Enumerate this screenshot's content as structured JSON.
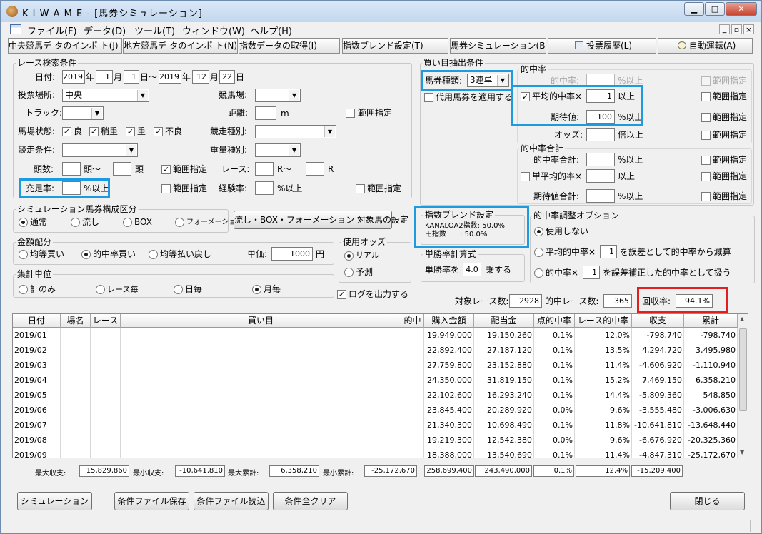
{
  "window": {
    "title": "K I W A M E - [馬券シミュレーション]",
    "min": "▁",
    "max": "□",
    "close": "✕"
  },
  "mdi": {
    "min": "‗",
    "restore": "▫",
    "close": "×"
  },
  "menu": [
    "ファイル(F)",
    "データ(D)",
    "ツール(T)",
    "ウィンドウ(W)",
    "ヘルプ(H)"
  ],
  "toolbar": [
    "中央競馬デ-タのインポ-ト(J)",
    "地方競馬デ-タのインポ-ト(N)",
    "指数データの取得(I)",
    "指数ブレンド設定(T)",
    "馬券シミュレーション(B)",
    "投票履歴(L)",
    "自動運転(A)"
  ],
  "search": {
    "title": "レース検索条件",
    "date_label": "日付:",
    "from_year": "2019",
    "from_month": "1",
    "from_day": "1",
    "to_year": "2019",
    "to_month": "12",
    "to_day": "22",
    "year": "年",
    "month": "月",
    "day_tilde": "日〜",
    "day": "日",
    "venue_label": "投票場所:",
    "venue_value": "中央",
    "course_label": "競馬場:",
    "track_label": "トラック:",
    "distance_label": "距離:",
    "distance_unit": "m",
    "range": "範囲指定",
    "condition_label": "馬場状態:",
    "conditions": [
      "良",
      "稍重",
      "重",
      "不良"
    ],
    "race_type_label": "競走種別:",
    "race_cond_label": "競走条件:",
    "weight_label": "重量種別:",
    "heads_label": "頭数:",
    "heads_unit1": "頭〜",
    "heads_unit2": "頭",
    "race_label": "レース:",
    "race_r1": "R〜",
    "race_r2": "R",
    "fill_label": "充足率:",
    "fill_unit": "%以上",
    "exp_label": "経験率:",
    "exp_unit": "%以上"
  },
  "buy": {
    "title": "買い目抽出条件",
    "ticket_label": "馬券種類:",
    "ticket_value": "3連単",
    "substitute": "代用馬券を適用する",
    "hit_title": "的中率",
    "hit_rate": "的中率:",
    "pct_up": "%以上",
    "avg_hit": "平均的中率×",
    "avg_hit_value": "1",
    "up": "以上",
    "expect": "期待値:",
    "expect_value": "100",
    "odds": "オッズ:",
    "odds_unit": "倍以上",
    "range": "範囲指定",
    "sum_title": "的中率合計",
    "sum_hit": "的中率合計:",
    "single_avg": "単平均的率×",
    "expect_sum": "期待値合計:"
  },
  "sim": {
    "title": "シミュレーション馬券構成区分",
    "options": [
      "通常",
      "流し",
      "BOX",
      "フォーメーション"
    ],
    "button": "流し・BOX・フォーメーション 対象馬の設定"
  },
  "blend": {
    "title": "指数ブレンド設定",
    "line1": "KANALOA2指数: 50.0%",
    "line2": "卍指数      : 50.0%"
  },
  "adjust": {
    "title": "的中率調整オプション",
    "opt1": "使用しない",
    "opt2": "平均的中率×",
    "opt2_value": "1",
    "opt2_tail": "を誤差として的中率から減算",
    "opt3": "的中率×",
    "opt3_value": "1",
    "opt3_tail": "を誤差補正した的中率として扱う"
  },
  "money": {
    "title": "金額配分",
    "options": [
      "均等買い",
      "的中率買い",
      "均等払い戻し"
    ],
    "unit_label": "単価:",
    "unit_value": "1000",
    "yen": "円"
  },
  "odds_use": {
    "title": "使用オッズ",
    "options": [
      "リアル",
      "予測"
    ]
  },
  "win_calc": {
    "title": "単勝率計算式",
    "label": "単勝率を",
    "value": "4.0",
    "tail": "乗する"
  },
  "agg": {
    "title": "集計単位",
    "options": [
      "計のみ",
      "レース毎",
      "日毎",
      "月毎"
    ]
  },
  "log_output": "ログを出力する",
  "summary": {
    "target_label": "対象レース数:",
    "target_value": "2928",
    "hit_label": "的中レース数:",
    "hit_value": "365",
    "return_label": "回収率:",
    "return_value": "94.1%"
  },
  "table": {
    "headers": [
      "日付",
      "場名",
      "レース",
      "買い目",
      "的中",
      "購入金額",
      "配当金",
      "点的中率",
      "レース的中率",
      "収支",
      "累計"
    ],
    "rows": [
      [
        "2019/01",
        "",
        "",
        "",
        "",
        "19,949,000",
        "19,150,260",
        "0.1%",
        "12.0%",
        "-798,740",
        "-798,740"
      ],
      [
        "2019/02",
        "",
        "",
        "",
        "",
        "22,892,400",
        "27,187,120",
        "0.1%",
        "13.5%",
        "4,294,720",
        "3,495,980"
      ],
      [
        "2019/03",
        "",
        "",
        "",
        "",
        "27,759,800",
        "23,152,880",
        "0.1%",
        "11.4%",
        "-4,606,920",
        "-1,110,940"
      ],
      [
        "2019/04",
        "",
        "",
        "",
        "",
        "24,350,000",
        "31,819,150",
        "0.1%",
        "15.2%",
        "7,469,150",
        "6,358,210"
      ],
      [
        "2019/05",
        "",
        "",
        "",
        "",
        "22,102,600",
        "16,293,240",
        "0.1%",
        "14.4%",
        "-5,809,360",
        "548,850"
      ],
      [
        "2019/06",
        "",
        "",
        "",
        "",
        "23,845,400",
        "20,289,920",
        "0.0%",
        "9.6%",
        "-3,555,480",
        "-3,006,630"
      ],
      [
        "2019/07",
        "",
        "",
        "",
        "",
        "21,340,300",
        "10,698,490",
        "0.1%",
        "11.8%",
        "-10,641,810",
        "-13,648,440"
      ],
      [
        "2019/08",
        "",
        "",
        "",
        "",
        "19,219,300",
        "12,542,380",
        "0.0%",
        "9.6%",
        "-6,676,920",
        "-20,325,360"
      ],
      [
        "2019/09",
        "",
        "",
        "",
        "",
        "18,388,000",
        "13,540,690",
        "0.1%",
        "11.4%",
        "-4,847,310",
        "-25,172,670"
      ]
    ]
  },
  "footer": {
    "max_profit_label": "最大収支:",
    "max_profit": "15,829,860",
    "min_profit_label": "最小収支:",
    "min_profit": "-10,641,810",
    "max_cum_label": "最大累計:",
    "max_cum": "6,358,210",
    "min_cum_label": "最小累計:",
    "min_cum": "-25,172,670",
    "total_buy": "258,699,400",
    "total_pay": "243,490,000",
    "total_point": "0.1%",
    "total_race": "12.4%",
    "total_profit": "-15,209,400"
  },
  "buttons": {
    "simulate": "シミュレーション",
    "save": "条件ファイル保存",
    "load": "条件ファイル読込",
    "clear": "条件全クリア",
    "close": "閉じる"
  }
}
